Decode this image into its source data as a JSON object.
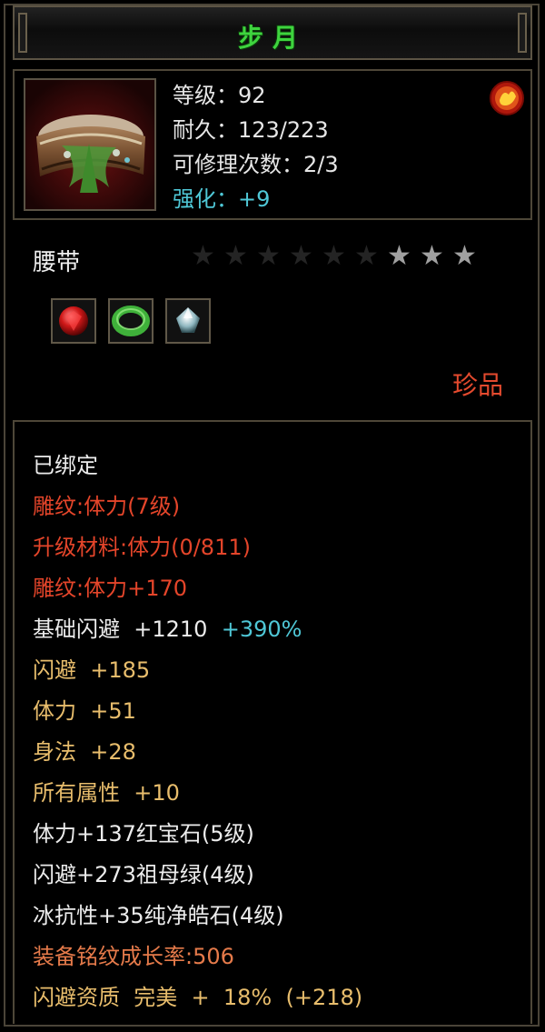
{
  "title": "步月",
  "header": {
    "stats": [
      {
        "text": "等级：92",
        "color": "white"
      },
      {
        "text": "耐久：123/223",
        "color": "white"
      },
      {
        "text": "可修理次数：2/3",
        "color": "white"
      },
      {
        "text": "强化：+9",
        "color": "cyan"
      }
    ]
  },
  "item_type": "腰带",
  "stars": {
    "filled": 3,
    "total": 9
  },
  "gems": [
    "ruby-gem-icon",
    "emerald-gem-icon",
    "diamond-gem-icon"
  ],
  "quality": "珍品",
  "attributes": [
    {
      "parts": [
        {
          "text": "已绑定",
          "color": "white"
        }
      ]
    },
    {
      "parts": [
        {
          "text": "雕纹:体力(7级)",
          "color": "red"
        }
      ]
    },
    {
      "parts": [
        {
          "text": "升级材料:体力(0/811)",
          "color": "red"
        }
      ]
    },
    {
      "parts": [
        {
          "text": "雕纹:体力+170",
          "color": "red"
        }
      ]
    },
    {
      "parts": [
        {
          "text": "基础闪避  +1210",
          "color": "white"
        },
        {
          "text": "  +390%",
          "color": "cyan"
        }
      ]
    },
    {
      "parts": [
        {
          "text": "闪避  +185",
          "color": "gold"
        }
      ]
    },
    {
      "parts": [
        {
          "text": "体力  +51",
          "color": "gold"
        }
      ]
    },
    {
      "parts": [
        {
          "text": "身法  +28",
          "color": "gold"
        }
      ]
    },
    {
      "parts": [
        {
          "text": "所有属性  +10",
          "color": "gold"
        }
      ]
    },
    {
      "parts": [
        {
          "text": "体力+137红宝石(5级)",
          "color": "white"
        }
      ]
    },
    {
      "parts": [
        {
          "text": "闪避+273祖母绿(4级)",
          "color": "white"
        }
      ]
    },
    {
      "parts": [
        {
          "text": "冰抗性+35纯净皓石(4级)",
          "color": "white"
        }
      ]
    },
    {
      "parts": [
        {
          "text": "装备铭纹成长率:506",
          "color": "orange"
        }
      ]
    },
    {
      "parts": [
        {
          "text": "闪避资质  完美  +  18%  (+218)",
          "color": "gold"
        }
      ]
    }
  ],
  "colors": {
    "title": "#3ed43e",
    "white": "#ececec",
    "red": "#e4452a",
    "gold": "#e8bd6c",
    "orange": "#e57a4a",
    "cyan": "#4fc7d6",
    "star_filled": "#a0a0a0",
    "star_empty": "#242424"
  }
}
